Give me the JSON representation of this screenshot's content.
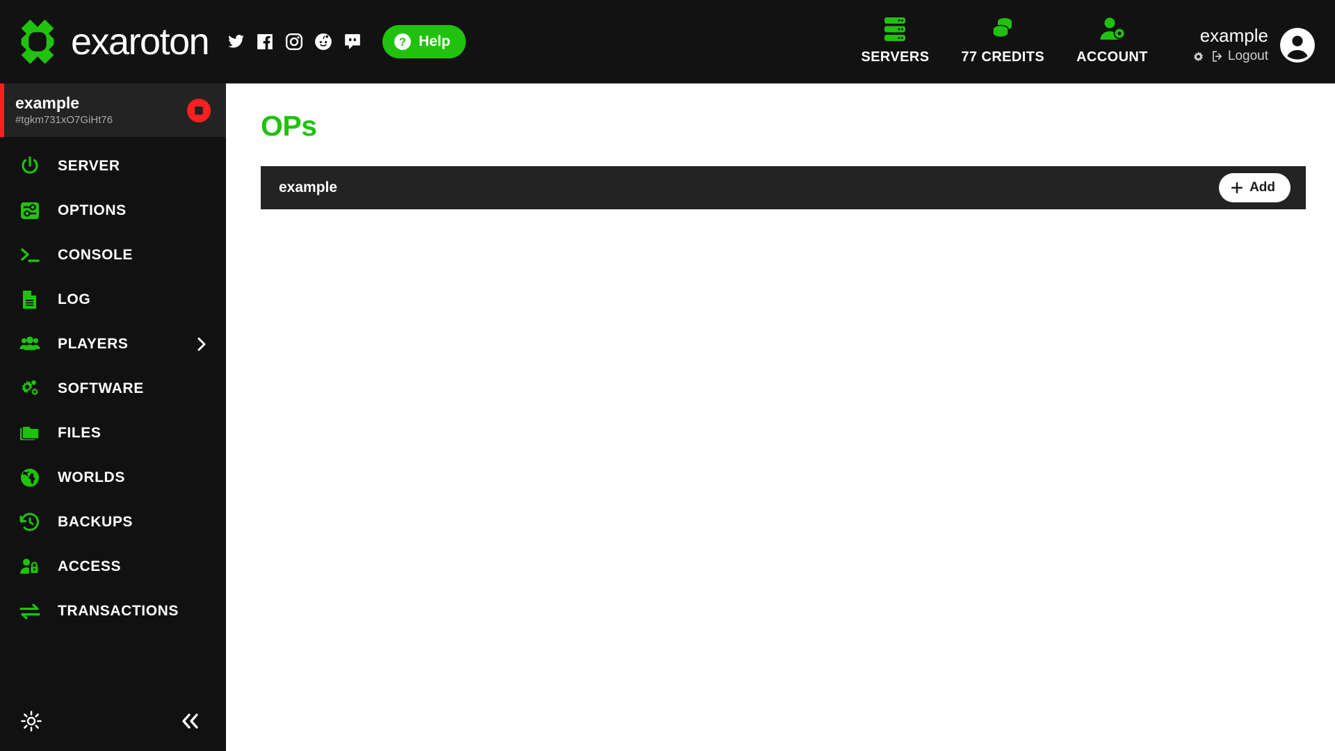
{
  "header": {
    "brand_name": "exaroton",
    "logo_icon": "exaroton-logo-icon",
    "socials": [
      {
        "name": "twitter-icon",
        "label": "Twitter"
      },
      {
        "name": "facebook-icon",
        "label": "Facebook"
      },
      {
        "name": "instagram-icon",
        "label": "Instagram"
      },
      {
        "name": "reddit-icon",
        "label": "Reddit"
      },
      {
        "name": "discord-icon",
        "label": "Discord"
      }
    ],
    "help_label": "Help",
    "help_icon": "question-circle-icon",
    "nav": [
      {
        "label": "SERVERS",
        "icon": "servers-icon"
      },
      {
        "label": "77 CREDITS",
        "icon": "credits-coins-icon"
      },
      {
        "label": "ACCOUNT",
        "icon": "account-gear-icon"
      }
    ],
    "account": {
      "name": "example",
      "settings_icon": "gear-icon",
      "logout_label": "Logout",
      "logout_icon": "logout-icon",
      "avatar_icon": "user-avatar-icon"
    }
  },
  "sidebar": {
    "server": {
      "name": "example",
      "id": "#tgkm731xO7GiHt76",
      "status_action_icon": "stop-button-icon",
      "status_color": "#ff1f1f"
    },
    "items": [
      {
        "label": "SERVER",
        "icon": "power-icon",
        "expandable": false
      },
      {
        "label": "OPTIONS",
        "icon": "sliders-icon",
        "expandable": false
      },
      {
        "label": "CONSOLE",
        "icon": "terminal-icon",
        "expandable": false
      },
      {
        "label": "LOG",
        "icon": "file-text-icon",
        "expandable": false
      },
      {
        "label": "PLAYERS",
        "icon": "users-icon",
        "expandable": true
      },
      {
        "label": "SOFTWARE",
        "icon": "cogs-icon",
        "expandable": false
      },
      {
        "label": "FILES",
        "icon": "folder-icon",
        "expandable": false
      },
      {
        "label": "WORLDS",
        "icon": "globe-icon",
        "expandable": false
      },
      {
        "label": "BACKUPS",
        "icon": "history-clock-icon",
        "expandable": false
      },
      {
        "label": "ACCESS",
        "icon": "user-lock-icon",
        "expandable": false
      },
      {
        "label": "TRANSACTIONS",
        "icon": "exchange-arrows-icon",
        "expandable": false
      }
    ],
    "footer": {
      "theme_icon": "sun-brightness-icon",
      "collapse_icon": "double-chevron-left-icon"
    }
  },
  "main": {
    "title": "OPs",
    "rows": [
      {
        "label": "example"
      }
    ],
    "add_label": "Add",
    "add_icon": "plus-icon"
  },
  "colors": {
    "accent_green": "#20c20e",
    "header_bg": "#121212",
    "sidebar_bg": "#111111",
    "panel_bg": "#232323",
    "status_red": "#ff1f1f",
    "page_bg": "#ffffff"
  }
}
